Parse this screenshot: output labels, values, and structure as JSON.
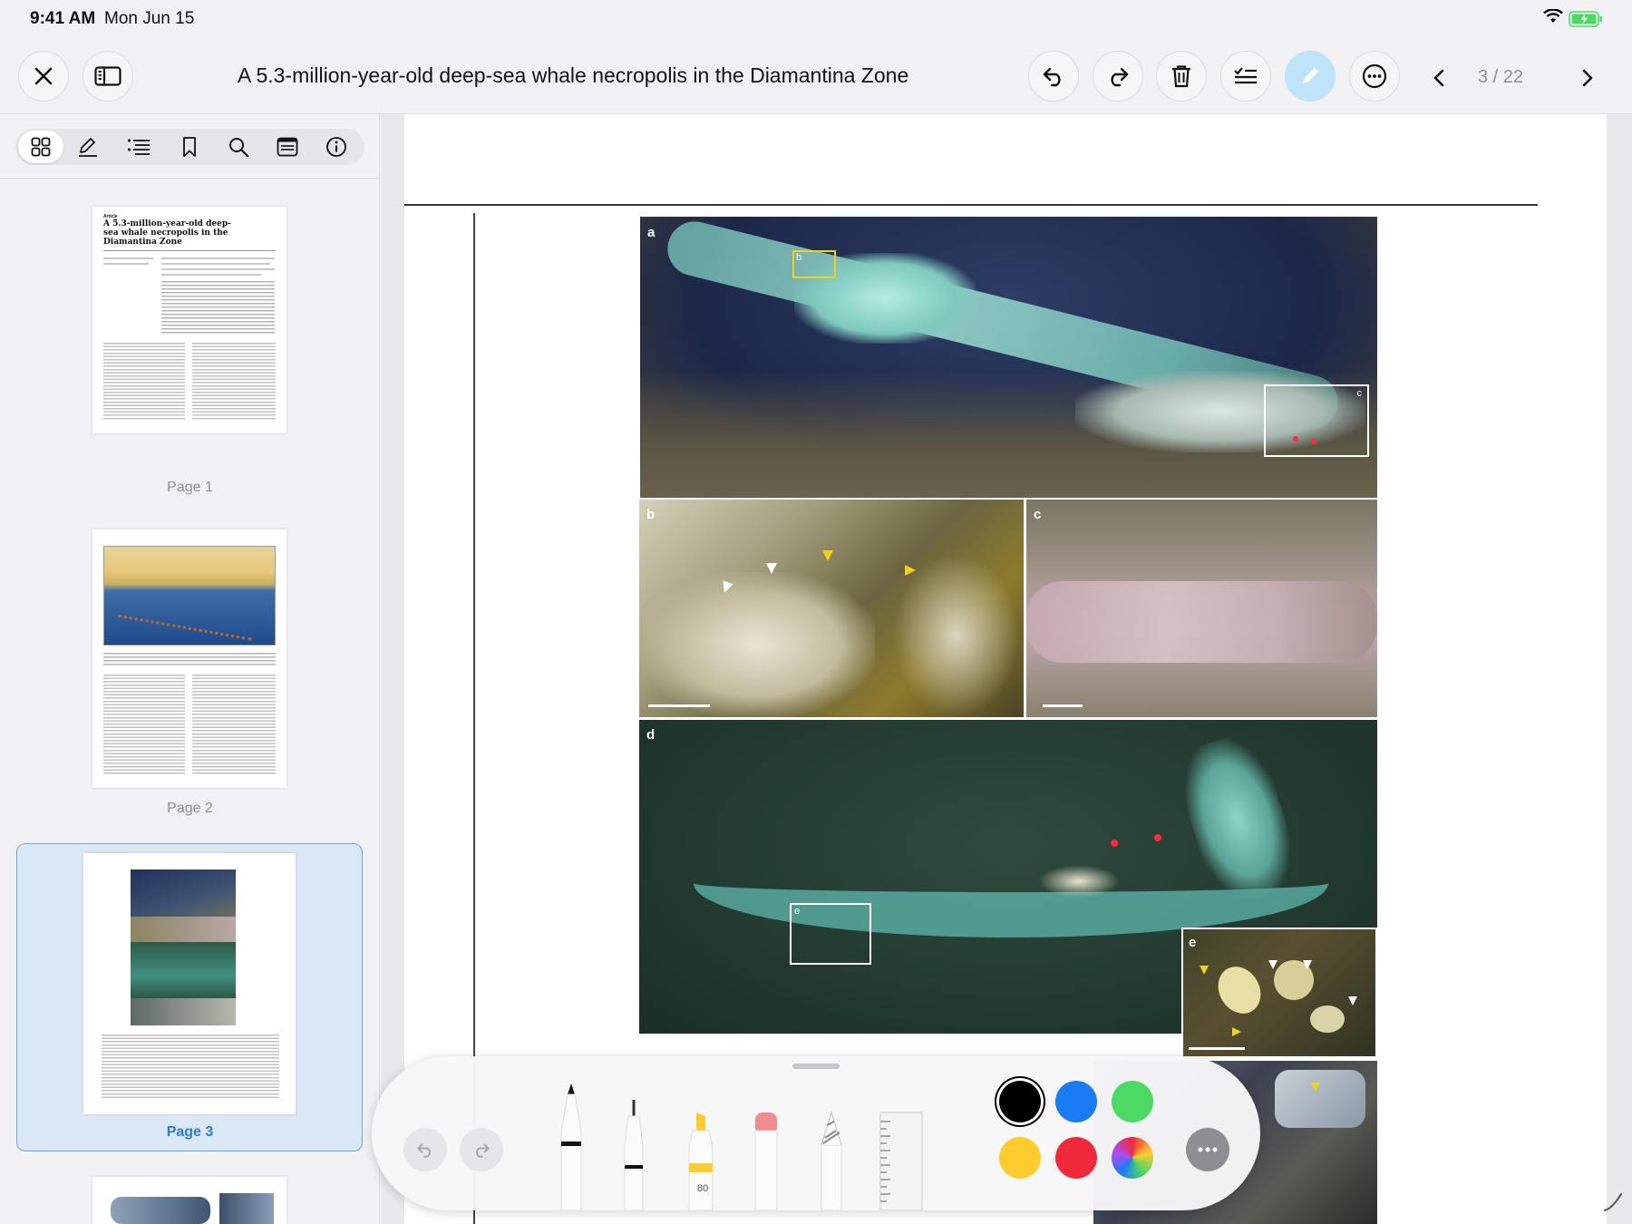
{
  "status_bar": {
    "time": "9:41 AM",
    "date": "Mon Jun 15"
  },
  "toolbar": {
    "title": "A 5.3-million-year-old deep-sea whale necropolis in the Diamantina Zone",
    "page_counter": "3 / 22",
    "accent": "#bfe3f8"
  },
  "sidebar": {
    "tabs": [
      "thumbnails-icon",
      "pencil-icon",
      "outline-icon",
      "bookmark-icon",
      "search-icon",
      "annotations-icon",
      "info-icon"
    ],
    "thumbnails": [
      {
        "label": "Page 1",
        "selected": false
      },
      {
        "label": "Page 2",
        "selected": false
      },
      {
        "label": "Page 3",
        "selected": true
      }
    ],
    "thumb1": {
      "kicker": "Article",
      "title": "A 5.3-million-year-old deep-sea whale necropolis in the Diamantina Zone"
    }
  },
  "figure": {
    "panels": [
      "a",
      "b",
      "c",
      "d",
      "e"
    ],
    "box_labels": {
      "b": "b",
      "c": "c",
      "e": "e"
    }
  },
  "markup": {
    "highlighter_value": "80",
    "colors": [
      "#000000",
      "#1a7cf2",
      "#4cd964",
      "#fecc2f",
      "#f02a3c"
    ]
  }
}
